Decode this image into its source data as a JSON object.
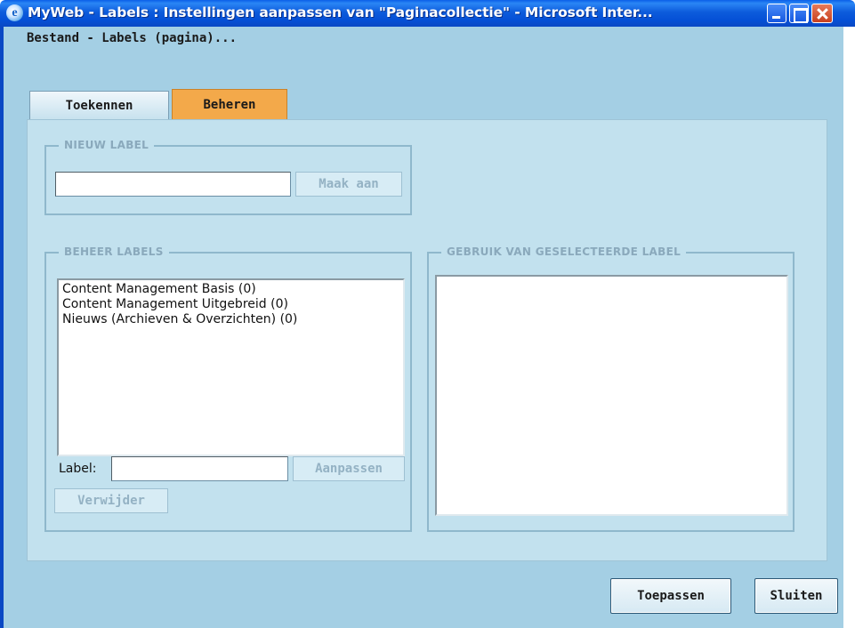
{
  "window": {
    "title": "MyWeb - Labels : Instellingen aanpassen van \"Paginacollectie\" - Microsoft Inter...",
    "icon": "ie-icon",
    "controls": [
      "minimize-icon",
      "maximize-icon",
      "close-icon"
    ]
  },
  "breadcrumb": "Bestand - Labels (pagina)...",
  "tabs": [
    {
      "label": "Toekennen",
      "active": false
    },
    {
      "label": "Beheren",
      "active": true
    }
  ],
  "new_label": {
    "legend": "NIEUW LABEL",
    "input_value": "",
    "button_label": "Maak aan"
  },
  "manage_labels": {
    "legend": "BEHEER LABELS",
    "items": [
      "Content Management Basis (0)",
      "Content Management Uitgebreid (0)",
      "Nieuws (Archieven & Overzichten) (0)"
    ],
    "label_caption": "Label:",
    "label_value": "",
    "adjust_button": "Aanpassen",
    "delete_button": "Verwijder"
  },
  "usage": {
    "legend": "GEBRUIK VAN GESELECTEERDE LABEL",
    "items": []
  },
  "footer": {
    "apply_button": "Toepassen",
    "close_button": "Sluiten"
  },
  "colors": {
    "titlebar": "#0550d6",
    "dialog_bg": "#a4cfe4",
    "panel_bg": "#c2e1ee",
    "active_tab": "#f3a94a",
    "legend_text": "#8aa9bc",
    "disabled_text": "#94b2c4"
  }
}
